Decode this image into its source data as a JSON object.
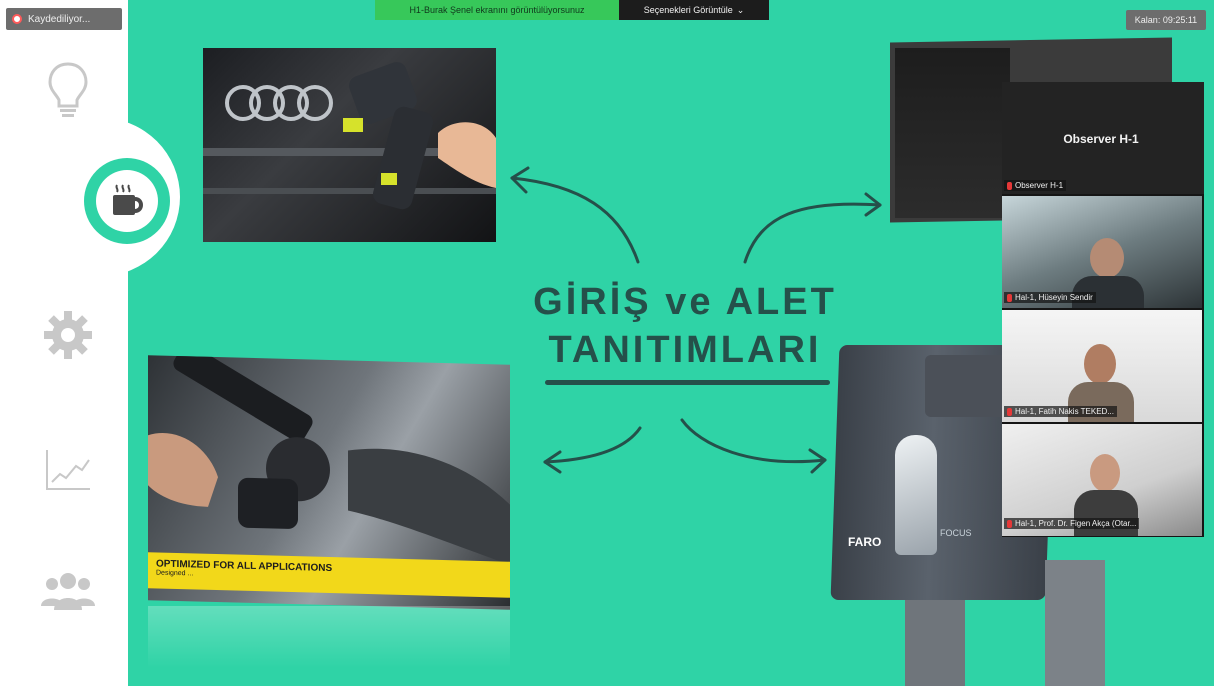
{
  "topbar": {
    "recording_label": "Kaydediliyor...",
    "share_status": "H1-Burak Şenel ekranını görüntülüyorsunuz",
    "view_options": "Seçenekleri Görüntüle",
    "timer": "Kalan: 09:25:11"
  },
  "sidebar": {
    "items": [
      {
        "icon": "lightbulb-icon"
      },
      {
        "icon": "coffee-icon",
        "active": true
      },
      {
        "icon": "gear-icon"
      },
      {
        "icon": "chart-icon"
      },
      {
        "icon": "group-icon"
      }
    ]
  },
  "slide": {
    "title_line1": "GİRİŞ ve ALET",
    "title_line2": "TANITIMLARI",
    "photo2_band_title": "OPTIMIZED FOR ALL APPLICATIONS",
    "photo2_band_sub": "Designed ...",
    "scanner_brand": "FARO",
    "scanner_model": "FOCUS",
    "colors": {
      "background": "#2fd3a6",
      "title": "#25504a"
    }
  },
  "participants": {
    "observer_tile_name": "Observer H-1",
    "observer_label": "Observer H-1",
    "tiles": [
      {
        "label": "Hal-1, Hüseyin Sendir"
      },
      {
        "label": "Hal-1, Fatih Nakis TEKED..."
      },
      {
        "label": "Hal-1, Prof. Dr. Figen Akça (Otar..."
      }
    ]
  }
}
